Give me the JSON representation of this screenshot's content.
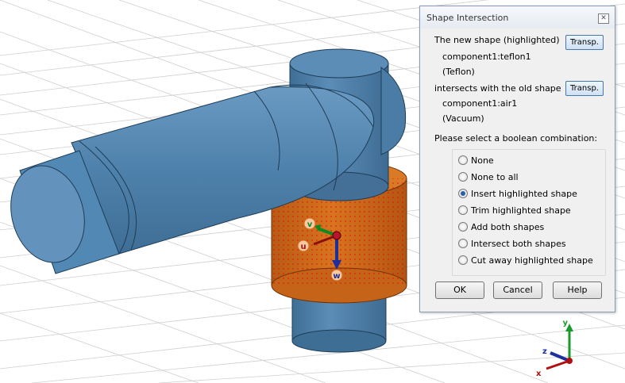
{
  "viewport": {
    "axes": {
      "x_label": "x",
      "y_label": "y",
      "z_label": "z"
    },
    "gizmo": {
      "u_label": "u",
      "v_label": "v",
      "w_label": "w"
    }
  },
  "dialog": {
    "title": "Shape Intersection",
    "close_glyph": "✕",
    "new_shape_label": "The new shape (highlighted)",
    "new_shape_name": "component1:teflon1",
    "new_shape_material": "(Teflon)",
    "old_shape_label": "intersects with the old shape",
    "old_shape_name": "component1:air1",
    "old_shape_material": "(Vacuum)",
    "transp_label": "Transp.",
    "prompt": "Please select a boolean combination:",
    "options": [
      {
        "label": "None",
        "selected": false
      },
      {
        "label": "None to all",
        "selected": false
      },
      {
        "label": "Insert highlighted shape",
        "selected": true
      },
      {
        "label": "Trim highlighted shape",
        "selected": false
      },
      {
        "label": "Add both shapes",
        "selected": false
      },
      {
        "label": "Intersect both shapes",
        "selected": false
      },
      {
        "label": "Cut away highlighted shape",
        "selected": false
      }
    ],
    "buttons": {
      "ok": "OK",
      "cancel": "Cancel",
      "help": "Help"
    }
  },
  "colors": {
    "shape_blue": "#4e81ab",
    "highlight_orange": "#cf6a1c",
    "dialog_bg": "#f0f0f0",
    "grid": "#cccccc"
  }
}
